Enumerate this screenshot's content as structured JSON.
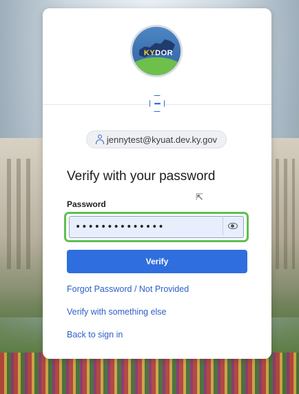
{
  "logo": {
    "text_ky": "KY",
    "text_dor": "DOR"
  },
  "user": {
    "email": "jennytest@kyuat.dev.ky.gov"
  },
  "heading": "Verify with your password",
  "password": {
    "label": "Password",
    "value": "••••••••••••••",
    "placeholder": ""
  },
  "verify_button": "Verify",
  "links": {
    "forgot": "Forgot Password / Not Provided",
    "verify_other": "Verify with something else",
    "back": "Back to sign in"
  },
  "colors": {
    "accent": "#2f6ede",
    "focus_ring": "#5fbf50",
    "link": "#2d5fc7"
  },
  "icons": {
    "password_indicator": "password-icon",
    "user": "user-icon",
    "show_password": "eye-icon"
  }
}
